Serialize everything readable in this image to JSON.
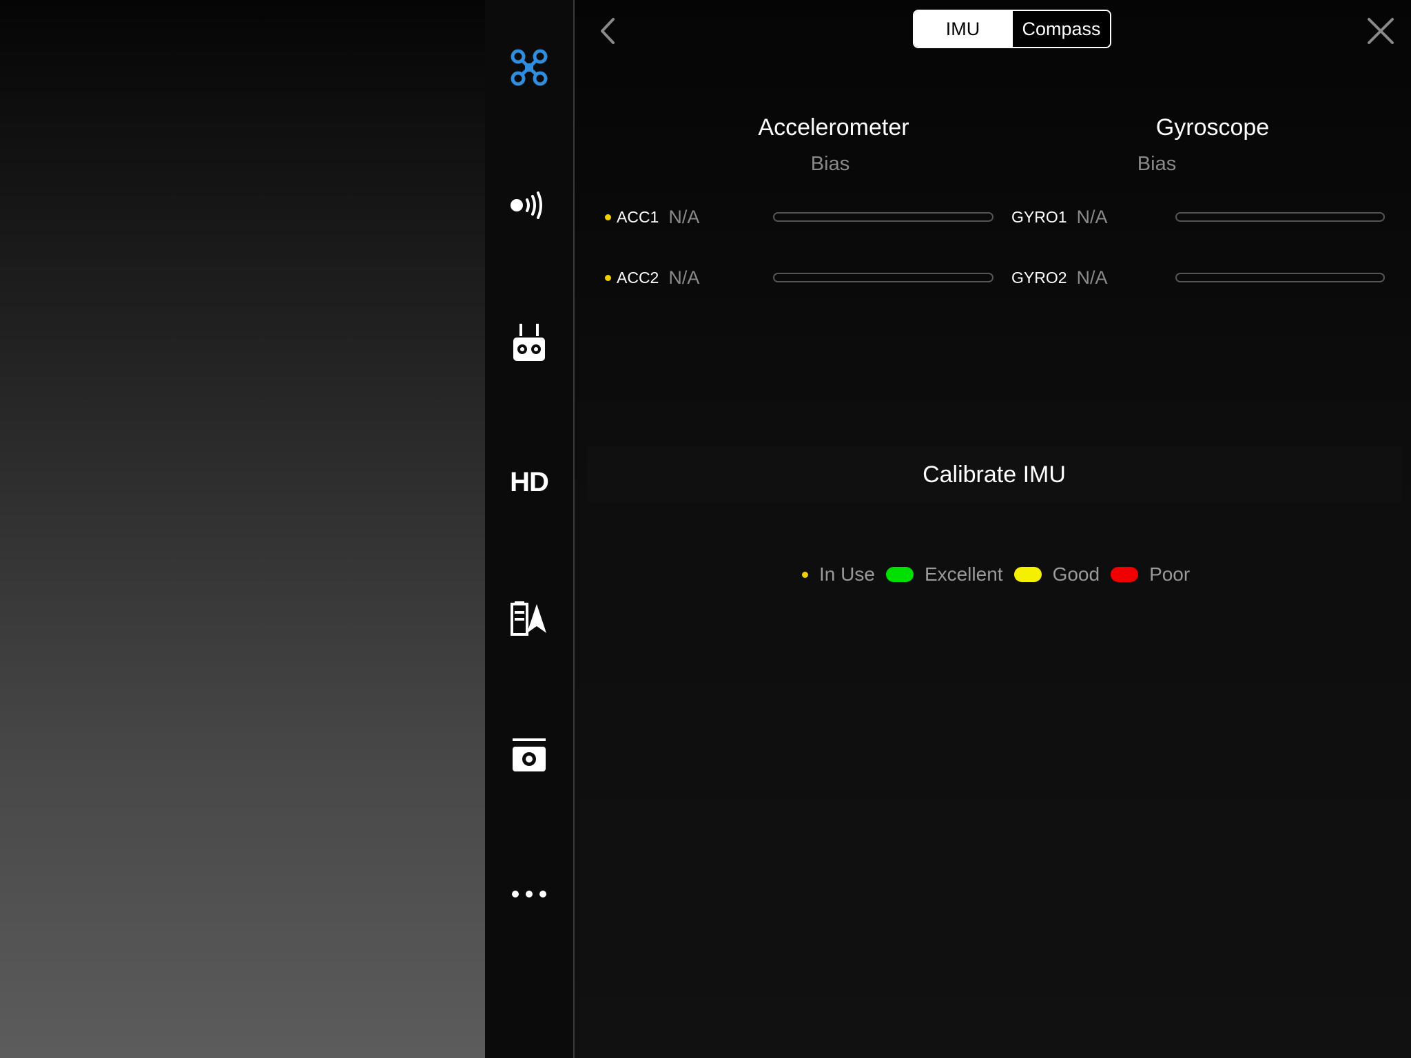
{
  "sidebar": {
    "items": [
      {
        "name": "aircraft",
        "icon": "drone-icon",
        "active": true
      },
      {
        "name": "sensors",
        "icon": "signal-waves-icon"
      },
      {
        "name": "remote-controller",
        "icon": "remote-controller-icon"
      },
      {
        "name": "hd-transmission",
        "icon": "hd-icon",
        "label": "HD"
      },
      {
        "name": "battery",
        "icon": "battery-flight-icon"
      },
      {
        "name": "camera",
        "icon": "camera-icon"
      },
      {
        "name": "more",
        "icon": "ellipsis-icon"
      }
    ]
  },
  "header": {
    "tabs": [
      {
        "label": "IMU",
        "active": true
      },
      {
        "label": "Compass",
        "active": false
      }
    ]
  },
  "accelerometer": {
    "title": "Accelerometer",
    "subtitle": "Bias",
    "sensors": [
      {
        "name": "ACC1",
        "value": "N/A",
        "in_use": true
      },
      {
        "name": "ACC2",
        "value": "N/A",
        "in_use": true
      }
    ]
  },
  "gyroscope": {
    "title": "Gyroscope",
    "subtitle": "Bias",
    "sensors": [
      {
        "name": "GYRO1",
        "value": "N/A",
        "in_use": false
      },
      {
        "name": "GYRO2",
        "value": "N/A",
        "in_use": false
      }
    ]
  },
  "calibrate_label": "Calibrate IMU",
  "legend": {
    "in_use": "In Use",
    "excellent": "Excellent",
    "good": "Good",
    "poor": "Poor"
  },
  "colors": {
    "accent": "#2f8ee0",
    "in_use": "#f0d000",
    "excellent": "#00e000",
    "good": "#f5f000",
    "poor": "#f00000"
  }
}
